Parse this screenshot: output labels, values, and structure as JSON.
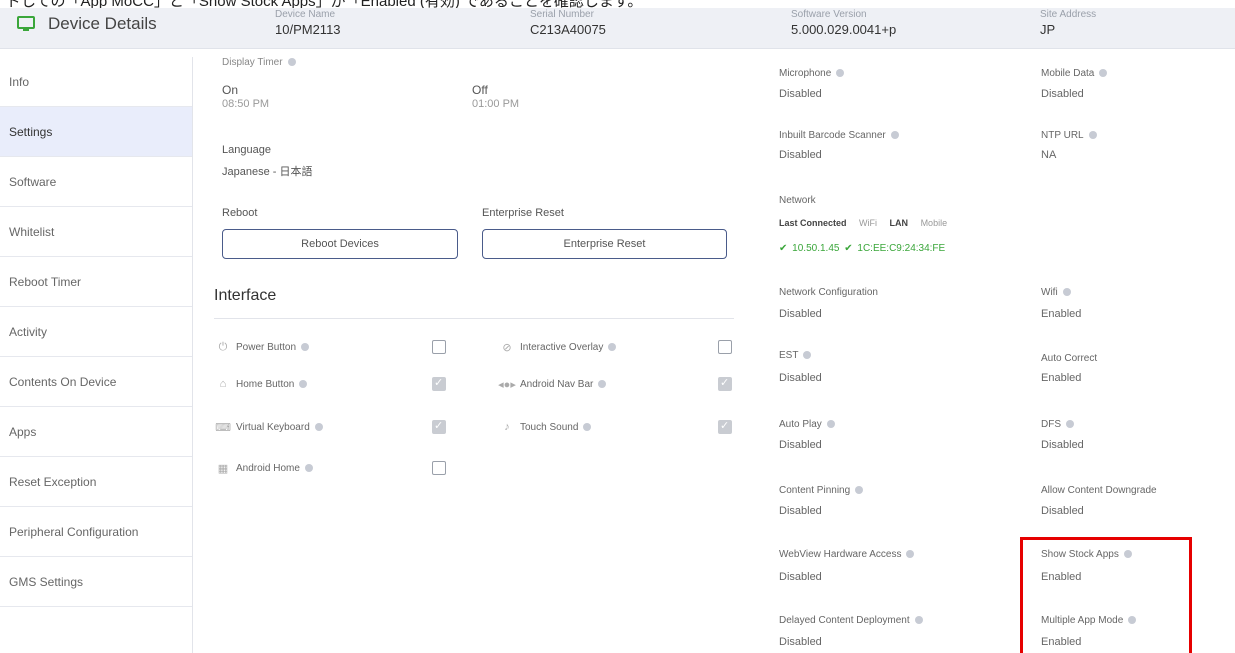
{
  "top_strip": {
    "text": "ドしての「App MoCC」と「Show Stock Apps」が「Enabled (有効) であることを確認します。"
  },
  "header": {
    "title": "Device Details",
    "columns": [
      {
        "label": "Device Name",
        "value": "10/PM2113"
      },
      {
        "label": "Serial Number",
        "value": "C213A40075"
      },
      {
        "label": "Software Version",
        "value": "5.000.029.0041+p"
      },
      {
        "label": "Site Address",
        "value": "JP"
      }
    ]
  },
  "sidebar": {
    "items": [
      {
        "label": "Info"
      },
      {
        "label": "Settings"
      },
      {
        "label": "Software"
      },
      {
        "label": "Whitelist"
      },
      {
        "label": "Reboot Timer"
      },
      {
        "label": "Activity"
      },
      {
        "label": "Contents On Device"
      },
      {
        "label": "Apps"
      },
      {
        "label": "Reset Exception"
      },
      {
        "label": "Peripheral Configuration"
      },
      {
        "label": "GMS Settings"
      }
    ],
    "active_index": 1
  },
  "display_timer": {
    "label": "Display Timer",
    "on_label": "On",
    "on_time": "08:50 PM",
    "off_label": "Off",
    "off_time": "01:00 PM"
  },
  "language": {
    "label": "Language",
    "value": "Japanese - 日本語"
  },
  "reboot": {
    "label": "Reboot",
    "button": "Reboot Devices"
  },
  "enterprise_reset": {
    "label": "Enterprise Reset",
    "button": "Enterprise Reset"
  },
  "interface": {
    "title": "Interface",
    "items": [
      {
        "label": "Power Button",
        "icon": "power-icon",
        "checked": false
      },
      {
        "label": "Interactive Overlay",
        "icon": "overlay-icon",
        "checked": false
      },
      {
        "label": "Home Button",
        "icon": "home-icon",
        "checked": true
      },
      {
        "label": "Android Nav Bar",
        "icon": "nav-bar-icon",
        "checked": true
      },
      {
        "label": "Virtual Keyboard",
        "icon": "keyboard-icon",
        "checked": true
      },
      {
        "label": "Touch Sound",
        "icon": "speaker-icon",
        "checked": true
      },
      {
        "label": "Android Home",
        "icon": "android-home-icon",
        "checked": false
      }
    ]
  },
  "right_settings": {
    "microphone": {
      "label": "Microphone",
      "value": "Disabled"
    },
    "mobile_data": {
      "label": "Mobile Data",
      "value": "Disabled"
    },
    "barcode": {
      "label": "Inbuilt Barcode Scanner",
      "value": "Disabled"
    },
    "ntp": {
      "label": "NTP URL",
      "value": "NA"
    },
    "network": {
      "label": "Network",
      "tabs": [
        "Last Connected",
        "WiFi",
        "LAN",
        "Mobile"
      ],
      "ip": "10.50.1.45",
      "mac": "1C:EE:C9:24:34:FE"
    },
    "net_config": {
      "label": "Network Configuration",
      "value": "Disabled"
    },
    "wifi": {
      "label": "Wifi",
      "value": "Enabled"
    },
    "est": {
      "label": "EST",
      "value": "Disabled"
    },
    "auto_correct": {
      "label": "Auto Correct",
      "value": "Enabled"
    },
    "auto_play": {
      "label": "Auto Play",
      "value": "Disabled"
    },
    "dfs": {
      "label": "DFS",
      "value": "Disabled"
    },
    "content_pinning": {
      "label": "Content Pinning",
      "value": "Disabled"
    },
    "allow_downgrade": {
      "label": "Allow Content Downgrade",
      "value": "Disabled"
    },
    "webview": {
      "label": "WebView Hardware Access",
      "value": "Disabled"
    },
    "show_stock": {
      "label": "Show Stock Apps",
      "value": "Enabled"
    },
    "delayed": {
      "label": "Delayed Content Deployment",
      "value": "Disabled"
    },
    "multi_app": {
      "label": "Multiple App Mode",
      "value": "Enabled"
    }
  },
  "colors": {
    "accent": "#3aa63a",
    "highlight": "#e60000",
    "active_bg": "#e9edfb"
  }
}
